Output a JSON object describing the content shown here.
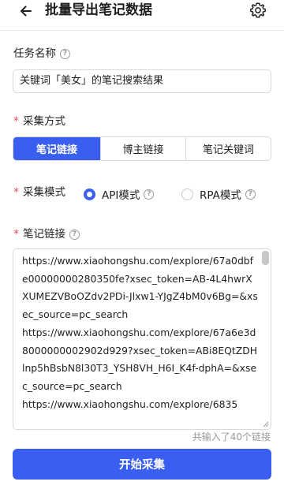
{
  "header": {
    "title": "批量导出笔记数据",
    "back_icon": "arrow-left-icon",
    "settings_icon": "gear-icon"
  },
  "task_name": {
    "label": "任务名称",
    "value": "关键词「美女」的笔记搜索结果"
  },
  "collect_method": {
    "label": "采集方式",
    "options": [
      "笔记链接",
      "博主链接",
      "笔记关键词"
    ],
    "selected": "笔记链接"
  },
  "collect_mode": {
    "label": "采集模式",
    "options": [
      "API模式",
      "RPA模式"
    ],
    "selected": "API模式"
  },
  "note_links": {
    "label": "笔记链接",
    "value": "https://www.xiaohongshu.com/explore/67a0dbfe00000000280350fe?xsec_token=AB-4L4hwrXXUMEZVBoOZdv2PDi-Jlxw1-YJgZ4bM0v6Bg=&xsec_source=pc_search\nhttps://www.xiaohongshu.com/explore/67a6e3d8000000002902d929?xsec_token=ABi8EQtZDHlnp5hBsbN8l30T3_YSH8VH_H6I_K4f-dphA=&xsec_source=pc_search\nhttps://www.xiaohongshu.com/explore/6835",
    "count_text": "共输入了40个链接"
  },
  "start_button": {
    "label": "开始采集"
  },
  "colors": {
    "accent": "#3a5ef0",
    "required": "#e34d59",
    "border": "#d9d9d9"
  }
}
